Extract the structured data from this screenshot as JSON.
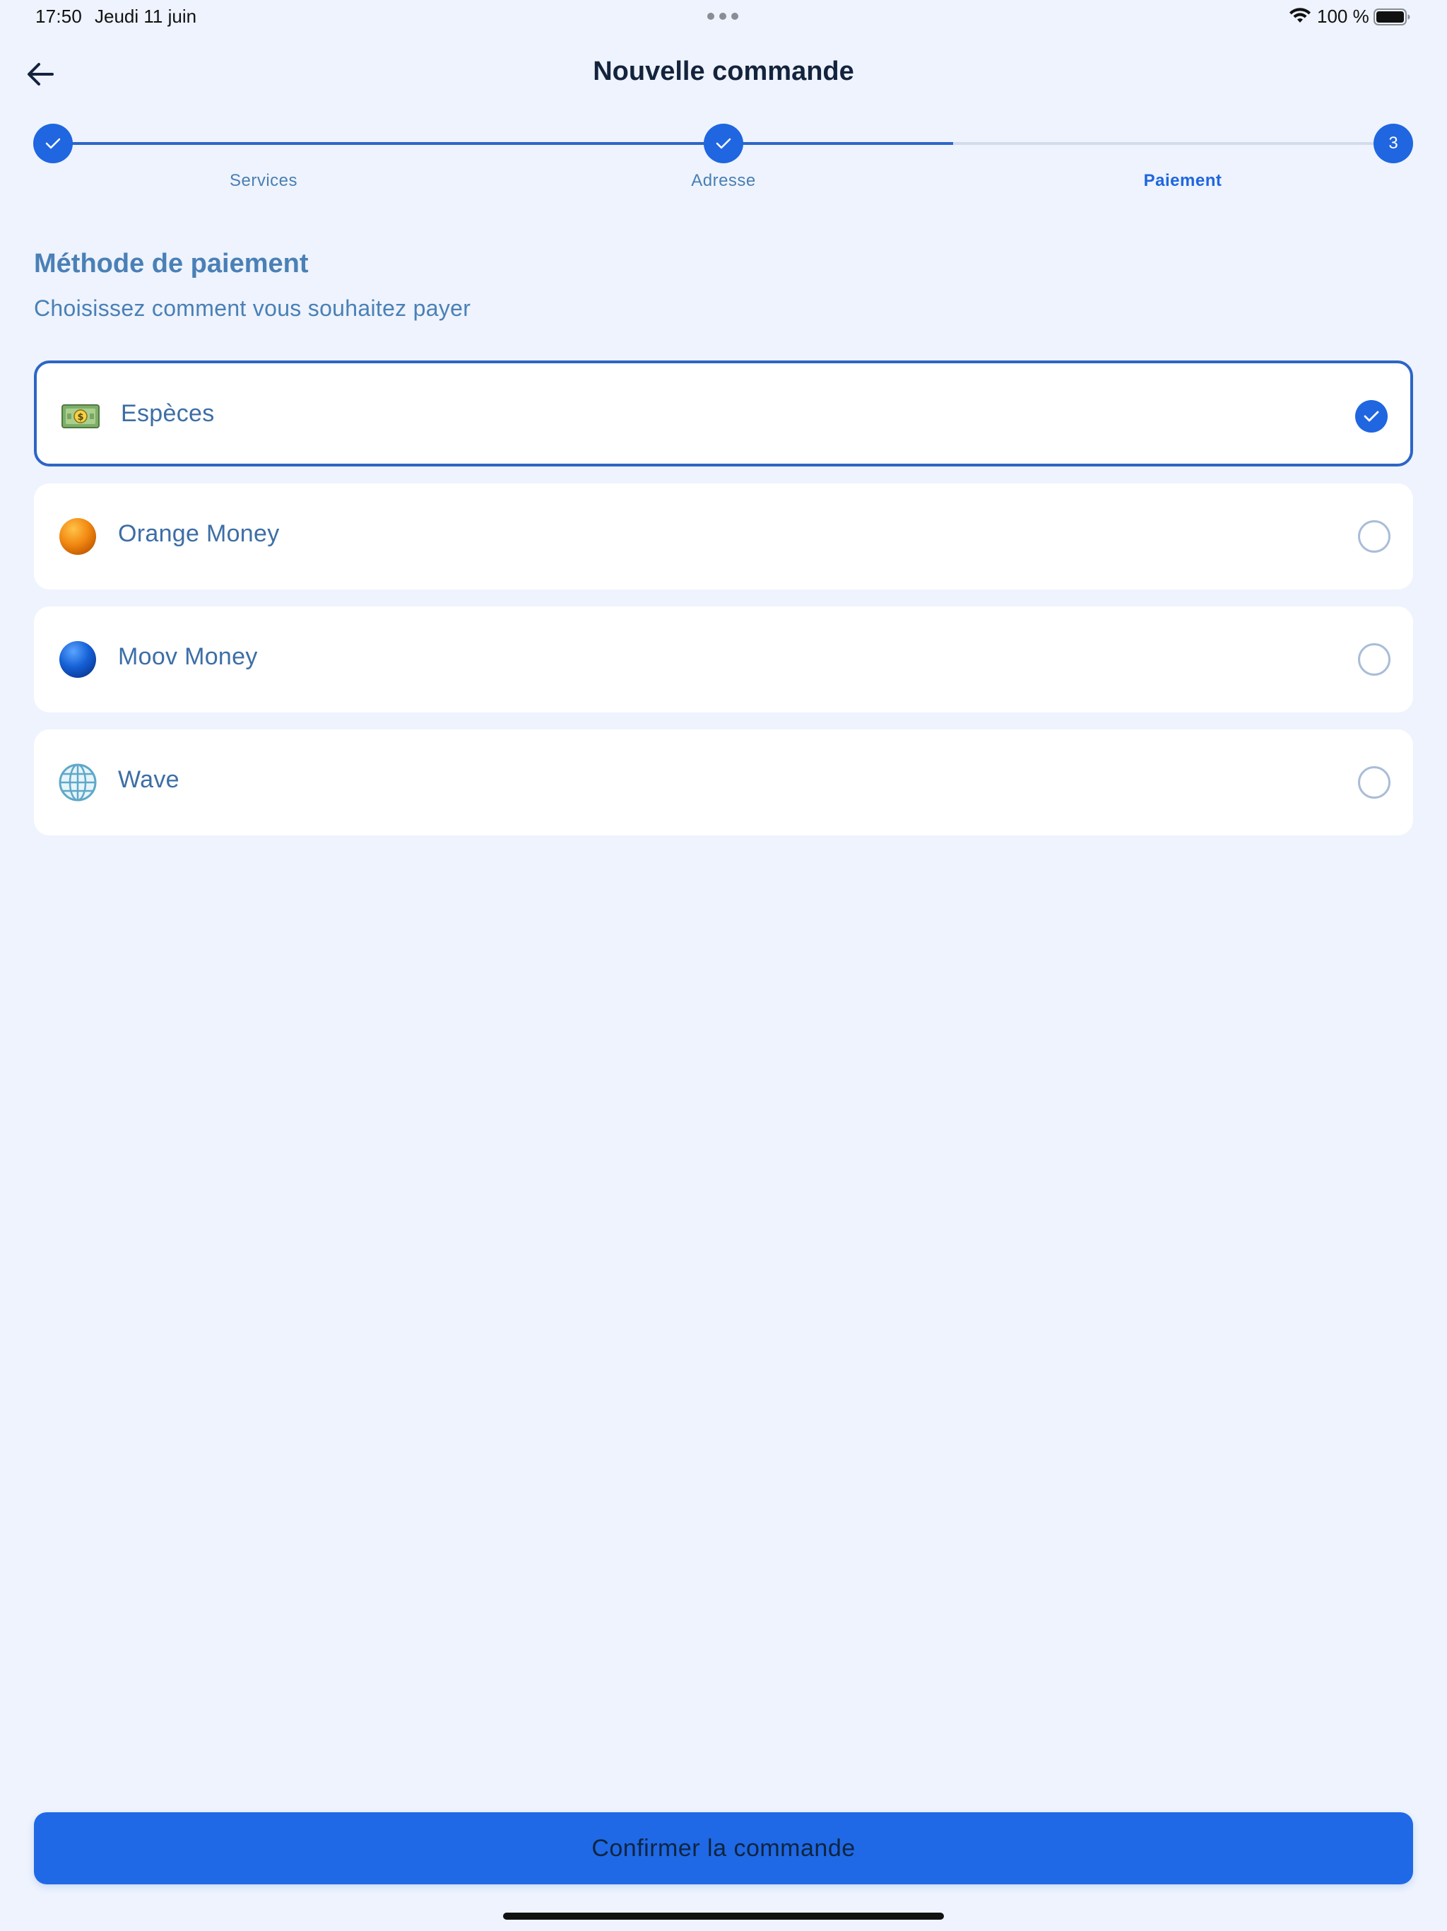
{
  "status_bar": {
    "time": "17:50",
    "date": "Jeudi 11 juin",
    "battery": "100 %"
  },
  "header": {
    "title": "Nouvelle commande",
    "back_icon": "arrow-left-icon"
  },
  "stepper": {
    "steps": [
      {
        "label": "Services",
        "state": "done"
      },
      {
        "label": "Adresse",
        "state": "done"
      },
      {
        "label": "Paiement",
        "state": "current",
        "number": "3"
      }
    ]
  },
  "section": {
    "title": "Méthode de paiement",
    "subtitle": "Choisissez comment vous souhaitez payer"
  },
  "payment_methods": [
    {
      "label": "Espèces",
      "icon": "banknote-icon",
      "selected": true
    },
    {
      "label": "Orange Money",
      "icon": "orange-circle-icon",
      "selected": false
    },
    {
      "label": "Moov Money",
      "icon": "blue-circle-icon",
      "selected": false
    },
    {
      "label": "Wave",
      "icon": "globe-icon",
      "selected": false
    }
  ],
  "footer": {
    "confirm_label": "Confirmer la commande"
  },
  "colors": {
    "background": "#eef3fd",
    "accent": "#1f66e0",
    "text_primary": "#14233d",
    "text_secondary": "#4a80b6"
  }
}
